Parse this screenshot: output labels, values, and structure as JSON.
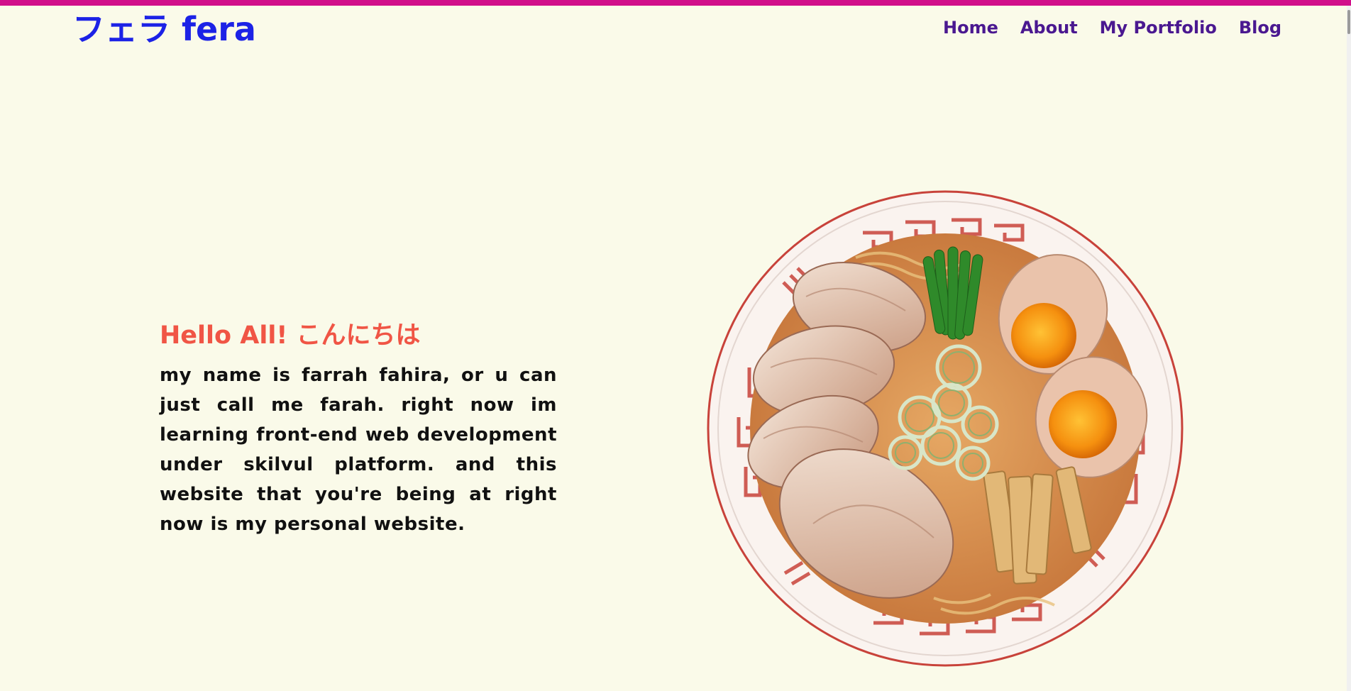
{
  "header": {
    "logo": "フェラ fera",
    "nav": [
      "Home",
      "About",
      "My Portfolio",
      "Blog"
    ]
  },
  "hero": {
    "greeting": "Hello All! こんにちは",
    "intro": "my name is farrah fahira, or u can just call me farah. right now im learning front-end web development under skilvul platform. and this website that you're being at right now is my personal website."
  },
  "colors": {
    "background": "#fafae9",
    "top_bar": "#d10f8a",
    "logo": "#1c22e6",
    "nav": "#4a1890",
    "greeting": "#f05545"
  }
}
